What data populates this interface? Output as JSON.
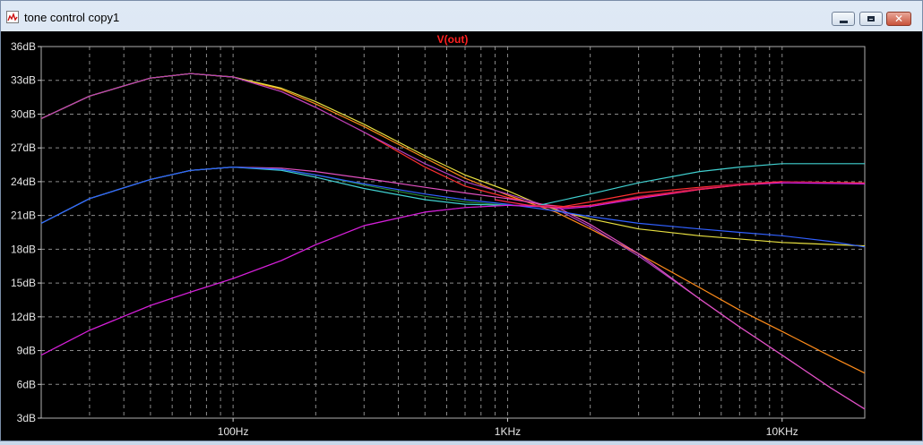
{
  "window": {
    "title": "tone control copy1",
    "icon": "waveform-plot-icon",
    "buttons": {
      "minimize": "minimize-icon",
      "maximize": "maximize-icon",
      "close": "close-icon"
    }
  },
  "chart_data": {
    "type": "line",
    "title": "V(out)",
    "xscale": "log",
    "xlim": [
      20,
      20000
    ],
    "ylim": [
      3,
      36
    ],
    "grid": true,
    "title_color": "#ff2020",
    "x_ticks": [
      {
        "value": 100,
        "label": "100Hz"
      },
      {
        "value": 1000,
        "label": "1KHz"
      },
      {
        "value": 10000,
        "label": "10KHz"
      }
    ],
    "y_ticks": [
      {
        "value": 36,
        "label": "36dB"
      },
      {
        "value": 33,
        "label": "33dB"
      },
      {
        "value": 30,
        "label": "30dB"
      },
      {
        "value": 27,
        "label": "27dB"
      },
      {
        "value": 24,
        "label": "24dB"
      },
      {
        "value": 21,
        "label": "21dB"
      },
      {
        "value": 18,
        "label": "18dB"
      },
      {
        "value": 15,
        "label": "15dB"
      },
      {
        "value": 12,
        "label": "12dB"
      },
      {
        "value": 9,
        "label": "9dB"
      },
      {
        "value": 6,
        "label": "6dB"
      },
      {
        "value": 3,
        "label": "3dB"
      }
    ],
    "series": [
      {
        "color": "#ff8c1a",
        "points": [
          [
            20,
            29.6
          ],
          [
            30,
            31.6
          ],
          [
            50,
            33.2
          ],
          [
            70,
            33.6
          ],
          [
            100,
            33.3
          ],
          [
            150,
            32.2
          ],
          [
            200,
            30.9
          ],
          [
            300,
            28.9
          ],
          [
            500,
            26.1
          ],
          [
            700,
            24.3
          ],
          [
            1000,
            22.8
          ],
          [
            1500,
            21.3
          ],
          [
            2000,
            19.8
          ],
          [
            3000,
            17.6
          ],
          [
            5000,
            14.6
          ],
          [
            7000,
            12.6
          ],
          [
            10000,
            10.7
          ],
          [
            15000,
            8.5
          ],
          [
            20000,
            7.0
          ]
        ]
      },
      {
        "color": "#ff3030",
        "points": [
          [
            20,
            29.6
          ],
          [
            30,
            31.6
          ],
          [
            50,
            33.2
          ],
          [
            70,
            33.6
          ],
          [
            100,
            33.3
          ],
          [
            150,
            32.0
          ],
          [
            200,
            30.6
          ],
          [
            300,
            28.4
          ],
          [
            500,
            25.3
          ],
          [
            700,
            23.6
          ],
          [
            1000,
            22.6
          ],
          [
            1300,
            22.0
          ],
          [
            1600,
            21.8
          ],
          [
            2000,
            22.2
          ],
          [
            3000,
            23.0
          ],
          [
            5000,
            23.5
          ],
          [
            7000,
            23.8
          ],
          [
            10000,
            24.0
          ],
          [
            20000,
            23.9
          ]
        ]
      },
      {
        "color": "#e8e040",
        "points": [
          [
            20,
            29.6
          ],
          [
            30,
            31.6
          ],
          [
            50,
            33.2
          ],
          [
            70,
            33.6
          ],
          [
            100,
            33.3
          ],
          [
            150,
            32.3
          ],
          [
            200,
            31.1
          ],
          [
            300,
            29.1
          ],
          [
            500,
            26.3
          ],
          [
            700,
            24.6
          ],
          [
            1000,
            23.2
          ],
          [
            1300,
            22.0
          ],
          [
            1600,
            21.3
          ],
          [
            2000,
            20.7
          ],
          [
            3000,
            19.8
          ],
          [
            5000,
            19.2
          ],
          [
            10000,
            18.6
          ],
          [
            20000,
            18.3
          ]
        ]
      },
      {
        "color": "#b040c0",
        "points": [
          [
            20,
            29.6
          ],
          [
            30,
            31.6
          ],
          [
            50,
            33.2
          ],
          [
            70,
            33.6
          ],
          [
            100,
            33.3
          ],
          [
            150,
            32.0
          ],
          [
            200,
            30.6
          ],
          [
            300,
            28.4
          ],
          [
            500,
            25.6
          ],
          [
            700,
            24.0
          ],
          [
            1000,
            22.9
          ],
          [
            1500,
            21.6
          ],
          [
            2000,
            20.0
          ],
          [
            3000,
            17.4
          ],
          [
            5000,
            13.6
          ],
          [
            7000,
            11.1
          ],
          [
            10000,
            8.6
          ],
          [
            15000,
            5.7
          ],
          [
            20000,
            3.8
          ]
        ]
      },
      {
        "color": "#e050c0",
        "points": [
          [
            20,
            20.3
          ],
          [
            30,
            22.5
          ],
          [
            50,
            24.2
          ],
          [
            70,
            25.0
          ],
          [
            100,
            25.3
          ],
          [
            150,
            25.2
          ],
          [
            200,
            24.9
          ],
          [
            300,
            24.3
          ],
          [
            500,
            23.5
          ],
          [
            700,
            23.0
          ],
          [
            1000,
            22.5
          ],
          [
            1500,
            21.8
          ],
          [
            2000,
            20.2
          ],
          [
            3000,
            17.6
          ],
          [
            5000,
            13.6
          ],
          [
            7000,
            11.1
          ],
          [
            10000,
            8.6
          ],
          [
            15000,
            5.7
          ],
          [
            20000,
            3.8
          ]
        ]
      },
      {
        "color": "#2a8a3a",
        "points": [
          [
            20,
            20.3
          ],
          [
            30,
            22.5
          ],
          [
            50,
            24.2
          ],
          [
            70,
            25.0
          ],
          [
            100,
            25.3
          ],
          [
            150,
            25.1
          ],
          [
            200,
            24.6
          ],
          [
            300,
            23.7
          ],
          [
            500,
            22.7
          ],
          [
            700,
            22.2
          ],
          [
            1000,
            21.9
          ],
          [
            1300,
            21.8
          ]
        ]
      },
      {
        "color": "#40d0d0",
        "points": [
          [
            20,
            20.3
          ],
          [
            30,
            22.5
          ],
          [
            50,
            24.2
          ],
          [
            70,
            25.0
          ],
          [
            100,
            25.3
          ],
          [
            150,
            25.0
          ],
          [
            200,
            24.4
          ],
          [
            300,
            23.4
          ],
          [
            500,
            22.4
          ],
          [
            700,
            22.0
          ],
          [
            1000,
            21.9
          ],
          [
            1300,
            21.9
          ],
          [
            2000,
            22.9
          ],
          [
            3000,
            23.9
          ],
          [
            5000,
            24.9
          ],
          [
            7000,
            25.3
          ],
          [
            10000,
            25.6
          ],
          [
            20000,
            25.6
          ]
        ]
      },
      {
        "color": "#3060ff",
        "points": [
          [
            20,
            20.3
          ],
          [
            30,
            22.5
          ],
          [
            50,
            24.2
          ],
          [
            70,
            25.0
          ],
          [
            100,
            25.3
          ],
          [
            150,
            25.1
          ],
          [
            200,
            24.6
          ],
          [
            300,
            23.8
          ],
          [
            500,
            22.9
          ],
          [
            700,
            22.4
          ],
          [
            1000,
            22.0
          ],
          [
            1500,
            21.4
          ],
          [
            2000,
            20.9
          ],
          [
            3000,
            20.3
          ],
          [
            5000,
            19.8
          ],
          [
            7000,
            19.5
          ],
          [
            10000,
            19.2
          ],
          [
            15000,
            18.7
          ],
          [
            20000,
            18.2
          ]
        ]
      },
      {
        "color": "#a01040",
        "points": [
          [
            20,
            8.6
          ],
          [
            30,
            10.8
          ],
          [
            50,
            13.0
          ],
          [
            70,
            14.2
          ],
          [
            100,
            15.4
          ],
          [
            150,
            17.0
          ],
          [
            200,
            18.4
          ],
          [
            300,
            20.1
          ],
          [
            500,
            21.3
          ],
          [
            700,
            21.7
          ],
          [
            1000,
            21.9
          ],
          [
            1300,
            21.9
          ],
          [
            1600,
            21.7
          ],
          [
            2000,
            21.9
          ],
          [
            3000,
            22.7
          ],
          [
            5000,
            23.4
          ],
          [
            7000,
            23.8
          ],
          [
            10000,
            24.0
          ],
          [
            20000,
            23.8
          ]
        ]
      },
      {
        "color": "#d020e0",
        "points": [
          [
            20,
            8.6
          ],
          [
            30,
            10.8
          ],
          [
            50,
            13.0
          ],
          [
            70,
            14.2
          ],
          [
            100,
            15.4
          ],
          [
            150,
            17.0
          ],
          [
            200,
            18.4
          ],
          [
            300,
            20.1
          ],
          [
            500,
            21.3
          ],
          [
            700,
            21.7
          ],
          [
            1000,
            21.9
          ],
          [
            1300,
            21.8
          ],
          [
            1600,
            21.6
          ],
          [
            2000,
            21.8
          ],
          [
            3000,
            22.5
          ],
          [
            5000,
            23.3
          ],
          [
            7000,
            23.7
          ],
          [
            10000,
            23.9
          ],
          [
            20000,
            23.8
          ]
        ]
      },
      {
        "color": "#ff2850",
        "points": [
          [
            900,
            22.4
          ],
          [
            1000,
            22.2
          ],
          [
            1200,
            21.9
          ],
          [
            1500,
            21.7
          ],
          [
            2000,
            21.9
          ],
          [
            3000,
            22.6
          ],
          [
            5000,
            23.3
          ],
          [
            7000,
            23.7
          ],
          [
            10000,
            24.0
          ]
        ]
      }
    ]
  }
}
